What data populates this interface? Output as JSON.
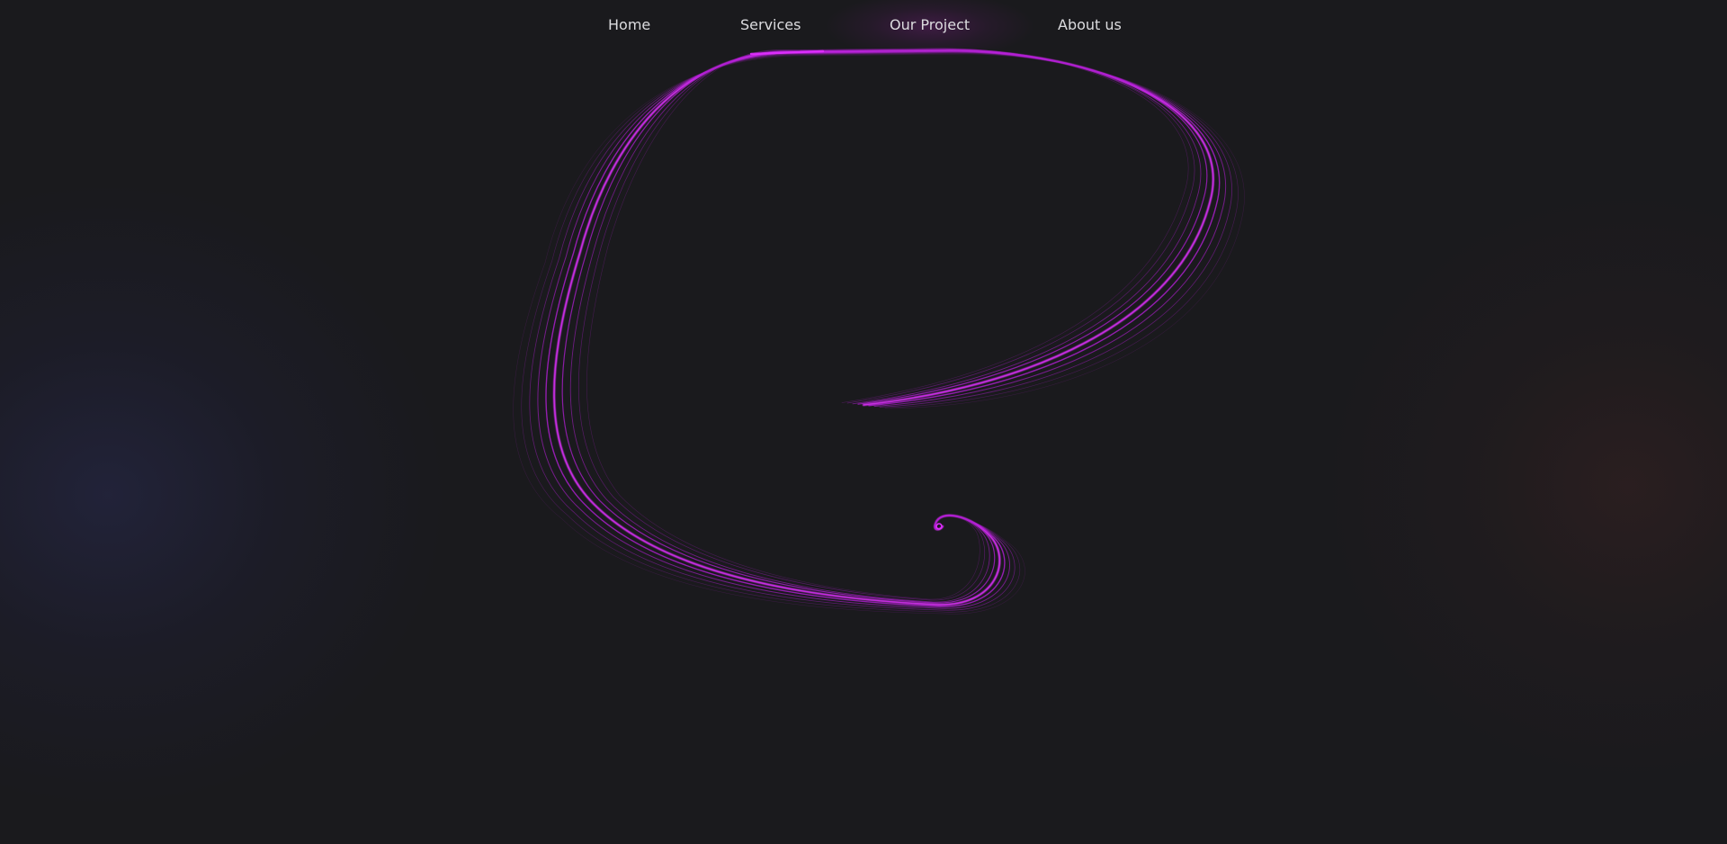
{
  "nav": {
    "items": [
      {
        "label": "Home"
      },
      {
        "label": "Services"
      },
      {
        "label": "Our Project",
        "active": true
      },
      {
        "label": "About us"
      }
    ]
  },
  "colors": {
    "background": "#1a1a1d",
    "trail": "#b21fd4",
    "trail_bright": "#e030ff",
    "glow_left": "#282a50",
    "glow_right": "#3a2222",
    "nav_text": "#dcdcdf"
  }
}
